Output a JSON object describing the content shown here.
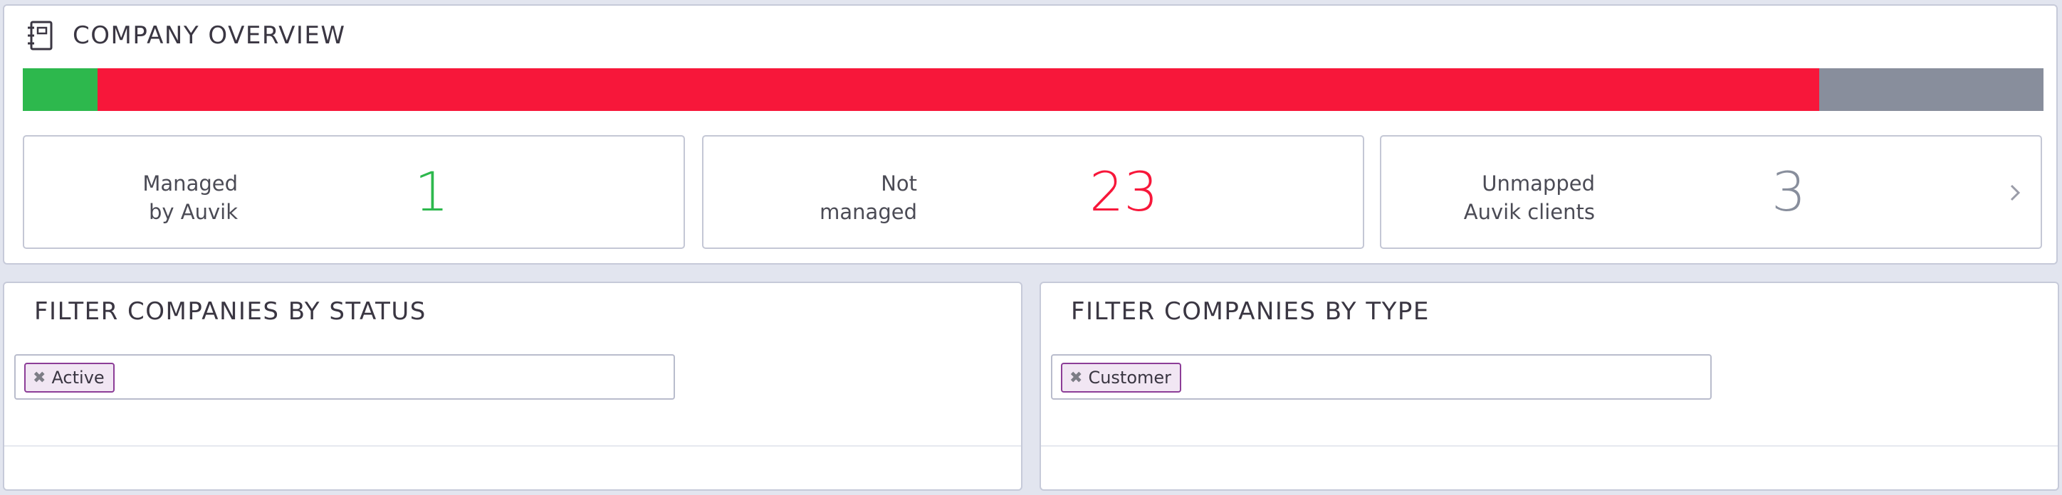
{
  "overview": {
    "title": "COMPANY OVERVIEW",
    "bar_segments": [
      {
        "name": "managed",
        "count": 1,
        "color": "#2db84d"
      },
      {
        "name": "not-managed",
        "count": 23,
        "color": "#f7173a"
      },
      {
        "name": "unmapped",
        "count": 3,
        "color": "#888e9c"
      }
    ],
    "cards": {
      "managed": {
        "label_line1": "Managed",
        "label_line2": "by Auvik",
        "value": "1",
        "color": "#2db84d"
      },
      "not_managed": {
        "label_line1": "Not",
        "label_line2": "managed",
        "value": "23",
        "color": "#f7173a"
      },
      "unmapped": {
        "label_line1": "Unmapped",
        "label_line2": "Auvik clients",
        "value": "3",
        "color": "#888e9c"
      }
    }
  },
  "status_filter": {
    "title": "FILTER COMPANIES BY STATUS",
    "chips": [
      "Active"
    ]
  },
  "type_filter": {
    "title": "FILTER COMPANIES BY TYPE",
    "chips": [
      "Customer"
    ]
  },
  "icons": {
    "overview": "notebook-icon",
    "chip_remove": "close-icon",
    "card_more": "chevron-right-icon"
  }
}
